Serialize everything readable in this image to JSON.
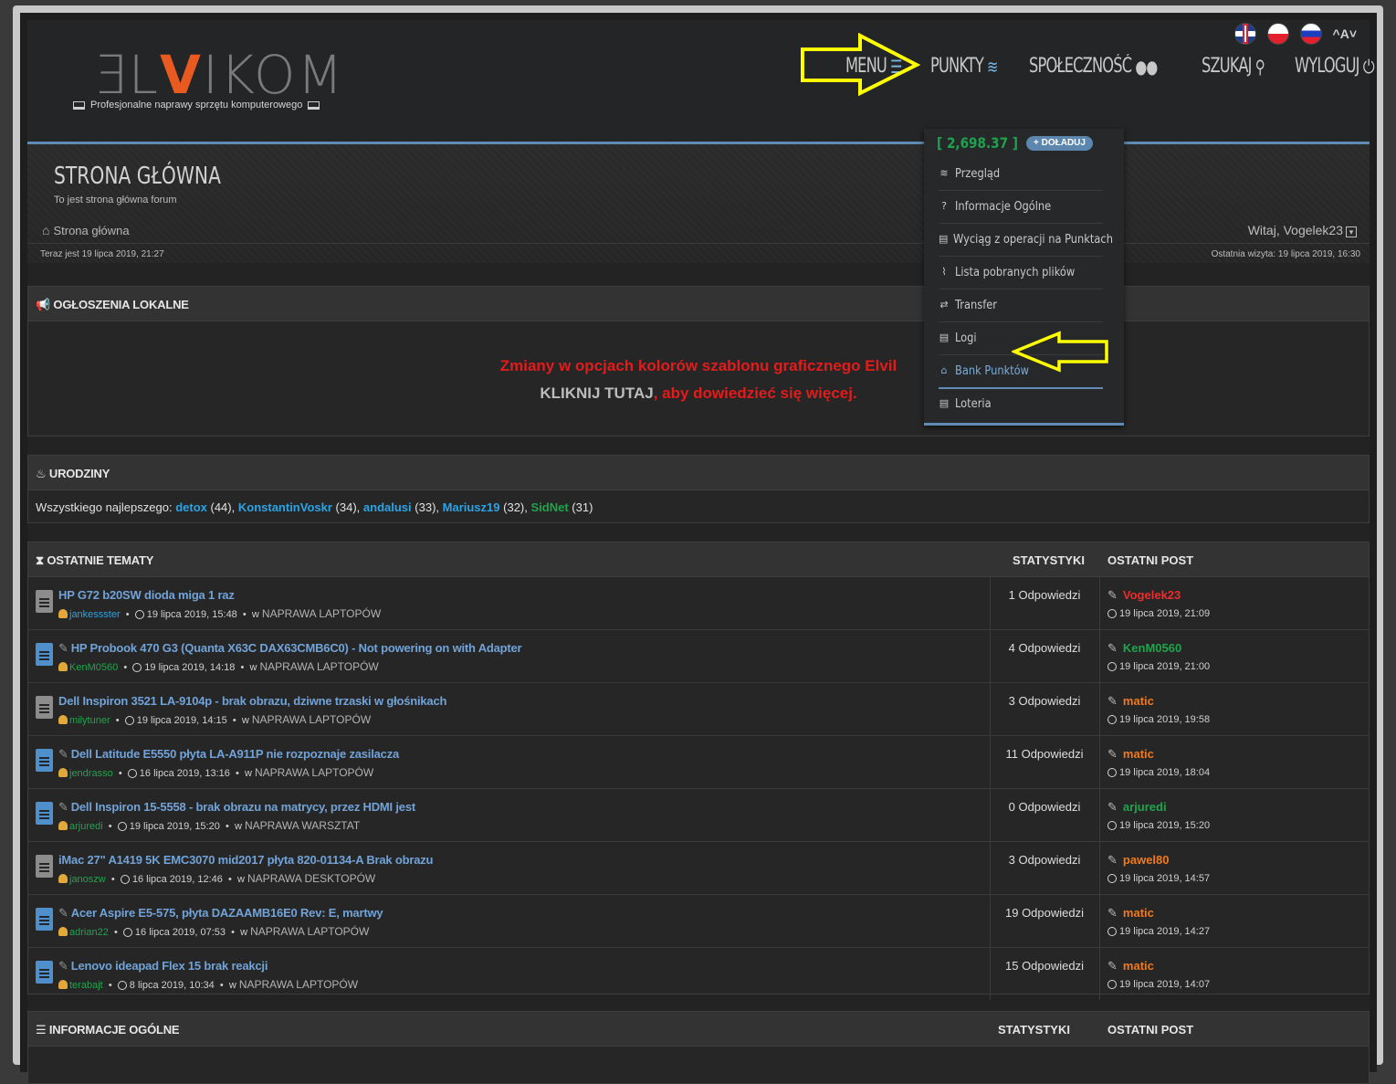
{
  "header": {
    "logo_part1": "ƎL",
    "logo_part2": "V",
    "logo_part3": "IKOM",
    "tagline": "Profesjonalne naprawy sprzętu komputerowego",
    "font_toggle": "^A˅",
    "nav": [
      {
        "label": "MENU",
        "icon": "menu-icon"
      },
      {
        "label": "PUNKTY",
        "icon": "coins-icon"
      },
      {
        "label": "SPOŁECZNOŚĆ",
        "icon": "users-icon"
      },
      {
        "label": "SZUKAJ",
        "icon": "search-icon"
      },
      {
        "label": "WYLOGUJ",
        "icon": "power-icon"
      }
    ]
  },
  "hero": {
    "title": "STRONA GŁÓWNA",
    "subtitle": "To jest strona główna forum",
    "breadcrumb": "Strona główna",
    "welcome": "Witaj, Vogelek23",
    "now": "Teraz jest 19 lipca 2019, 21:27",
    "last_visit": "Ostatnia wizyta: 19 lipca 2019, 16:30"
  },
  "announcements": {
    "title": "OGŁOSZENIA LOKALNE",
    "line1": "Zmiany w opcjach kolorów szablonu graficznego Elvil",
    "line2_link": "KLIKNIJ TUTAJ",
    "line2_rest": ", aby dowiedzieć się więcej."
  },
  "birthdays": {
    "title": "URODZINY",
    "prefix": "Wszystkiego najlepszego:",
    "people": [
      {
        "name": "detox",
        "age": "(44),",
        "color": "blue"
      },
      {
        "name": "KonstantinVoskr",
        "age": "(34),",
        "color": "blue"
      },
      {
        "name": "andalusi",
        "age": "(33),",
        "color": "blue"
      },
      {
        "name": "Mariusz19",
        "age": "(32),",
        "color": "blue"
      },
      {
        "name": "SidNet",
        "age": "(31)",
        "color": "green"
      }
    ]
  },
  "recent": {
    "title": "OSTATNIE TEMATY",
    "col_stats": "STATYSTYKI",
    "col_last": "OSTATNI POST",
    "topics": [
      {
        "title": "HP G72 b20SW dioda miga 1 raz",
        "edited": false,
        "doc": "gray",
        "author": "jankessster",
        "author_color": "blue",
        "date": "19 lipca 2019, 15:48",
        "forum_prefix": "w",
        "forum": "NAPRAWA LAPTOPÓW",
        "replies": "1 Odpowiedzi",
        "last_user": "Vogelek23",
        "last_color": "red",
        "last_date": "19 lipca 2019, 21:09"
      },
      {
        "title": "HP Probook 470 G3 (Quanta X63C DAX63CMB6C0) - Not powering on with Adapter",
        "edited": true,
        "doc": "blue",
        "author": "KenM0560",
        "author_color": "green",
        "date": "19 lipca 2019, 14:18",
        "forum_prefix": "w",
        "forum": "NAPRAWA LAPTOPÓW",
        "replies": "4 Odpowiedzi",
        "last_user": "KenM0560",
        "last_color": "green",
        "last_date": "19 lipca 2019, 21:00"
      },
      {
        "title": "Dell Inspiron 3521 LA-9104p - brak obrazu, dziwne trzaski w głośnikach",
        "edited": false,
        "doc": "gray",
        "author": "milytuner",
        "author_color": "green",
        "date": "19 lipca 2019, 14:15",
        "forum_prefix": "w",
        "forum": "NAPRAWA LAPTOPÓW",
        "replies": "3 Odpowiedzi",
        "last_user": "matic",
        "last_color": "orange",
        "last_date": "19 lipca 2019, 19:58"
      },
      {
        "title": "Dell Latitude E5550 płyta LA-A911P nie rozpoznaje zasilacza",
        "edited": true,
        "doc": "blue",
        "author": "jendrasso",
        "author_color": "green",
        "date": "16 lipca 2019, 13:16",
        "forum_prefix": "w",
        "forum": "NAPRAWA LAPTOPÓW",
        "replies": "11 Odpowiedzi",
        "last_user": "matic",
        "last_color": "orange",
        "last_date": "19 lipca 2019, 18:04"
      },
      {
        "title": "Dell Inspiron 15-5558 - brak obrazu na matrycy, przez HDMI jest",
        "edited": true,
        "doc": "blue",
        "author": "arjuredi",
        "author_color": "green",
        "date": "19 lipca 2019, 15:20",
        "forum_prefix": "w",
        "forum": "NAPRAWA WARSZTAT",
        "replies": "0 Odpowiedzi",
        "last_user": "arjuredi",
        "last_color": "green",
        "last_date": "19 lipca 2019, 15:20"
      },
      {
        "title": "iMac 27\" A1419 5K EMC3070 mid2017 płyta 820-01134-A Brak obrazu",
        "edited": false,
        "doc": "gray",
        "author": "janoszw",
        "author_color": "green",
        "date": "16 lipca 2019, 12:46",
        "forum_prefix": "w",
        "forum": "NAPRAWA DESKTOPÓW",
        "replies": "3 Odpowiedzi",
        "last_user": "pawel80",
        "last_color": "orange",
        "last_date": "19 lipca 2019, 14:57"
      },
      {
        "title": "Acer Aspire E5-575, płyta DAZAAMB16E0 Rev: E, martwy",
        "edited": true,
        "doc": "blue",
        "author": "adrian22",
        "author_color": "green",
        "date": "16 lipca 2019, 07:53",
        "forum_prefix": "w",
        "forum": "NAPRAWA LAPTOPÓW",
        "replies": "19 Odpowiedzi",
        "last_user": "matic",
        "last_color": "orange",
        "last_date": "19 lipca 2019, 14:27"
      },
      {
        "title": "Lenovo ideapad Flex 15 brak reakcji",
        "edited": true,
        "doc": "blue",
        "author": "terabajt",
        "author_color": "green",
        "date": "8 lipca 2019, 10:34",
        "forum_prefix": "w",
        "forum": "NAPRAWA LAPTOPÓW",
        "replies": "15 Odpowiedzi",
        "last_user": "matic",
        "last_color": "orange",
        "last_date": "19 lipca 2019, 14:07"
      }
    ]
  },
  "info": {
    "title": "INFORMACJE OGÓLNE",
    "col_stats": "STATYSTYKI",
    "col_last": "OSTATNI POST"
  },
  "dropdown": {
    "points": "[ 2,698.37 ]",
    "topup": "+ DOŁADUJ",
    "items": [
      {
        "label": "Przegląd",
        "icon": "coins-icon"
      },
      {
        "label": "Informacje Ogólne",
        "icon": "question-icon"
      },
      {
        "label": "Wyciąg z operacji na Punktach",
        "icon": "clipboard-icon"
      },
      {
        "label": "Lista pobranych plików",
        "icon": "paperclip-icon"
      },
      {
        "label": "Transfer",
        "icon": "exchange-icon"
      },
      {
        "label": "Logi",
        "icon": "list-icon"
      },
      {
        "label": "Bank Punktów",
        "icon": "bank-icon"
      },
      {
        "label": "Loteria",
        "icon": "ticket-icon"
      }
    ]
  },
  "colors": {
    "accent_blue": "#5f8bb5",
    "link_blue": "#71a3d8",
    "user_blue": "#2aa4e6",
    "user_green": "#1ea54b",
    "user_red": "#ef2b2b",
    "user_orange": "#f07a1f",
    "points_green": "#1fa24d",
    "annotation_yellow": "#ffff00",
    "logo_orange": "#e85a1f"
  }
}
